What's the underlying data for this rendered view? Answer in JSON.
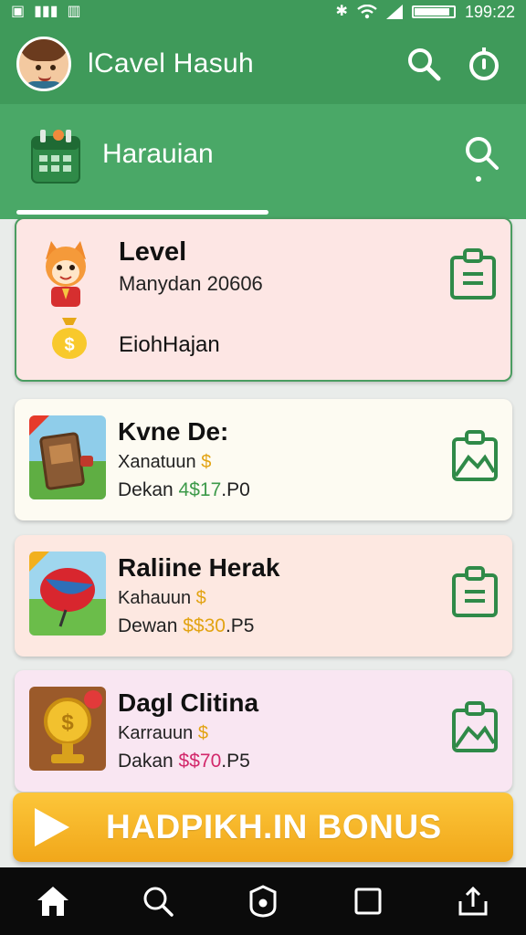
{
  "status_bar": {
    "time": "199:22",
    "battery_level": 0.9
  },
  "app_bar": {
    "title": "lCavel Hasuh",
    "avatar_icon": "boy-avatar",
    "actions": [
      "search-icon",
      "timer-icon"
    ]
  },
  "tab": {
    "label": "Harauian",
    "icon": "calendar-icon",
    "action_icon": "search-icon"
  },
  "level_card": {
    "title": "Level",
    "subtitle": "Manydan 20606",
    "coin_label": "EiohHajan",
    "mascot_icon": "fox-mascot",
    "coin_icon": "coin-bag-icon",
    "action_icon": "clipboard-icon"
  },
  "games": [
    {
      "title": "Kvne De:",
      "line1": "Xanatuun",
      "line1_symbol": "$",
      "line2_label": "Dekan",
      "amount": "4$17",
      "suffix": ".P0",
      "amount_color": "#3d9a4a",
      "thumb": "treasure-cabinet",
      "action_icon": "image-icon"
    },
    {
      "title": "Raliine Herak",
      "line1": "Kahauun",
      "line1_symbol": "$",
      "line2_label": "Dewan",
      "amount": "$$30",
      "suffix": ".P5",
      "amount_color": "#e2a312",
      "thumb": "red-balloon",
      "action_icon": "clipboard-icon"
    },
    {
      "title": "Dagl Clitina",
      "line1": "Karrauun",
      "line1_symbol": "$",
      "line2_label": "Dakan",
      "amount": "$$70",
      "suffix": ".P5",
      "amount_color": "#d2286b",
      "thumb": "gold-trophy",
      "action_icon": "image-icon"
    }
  ],
  "bonus_button": {
    "label": "HADPIKH.IN BONUS",
    "icon": "play-icon"
  },
  "bottom_nav": [
    "home-icon",
    "search-icon",
    "shield-icon",
    "square-icon",
    "share-icon"
  ],
  "colors": {
    "primary": "#3f9a5a",
    "tab": "#4aa867",
    "accent_gold": "#f4b325",
    "nav_bg": "#0b0b0b"
  }
}
